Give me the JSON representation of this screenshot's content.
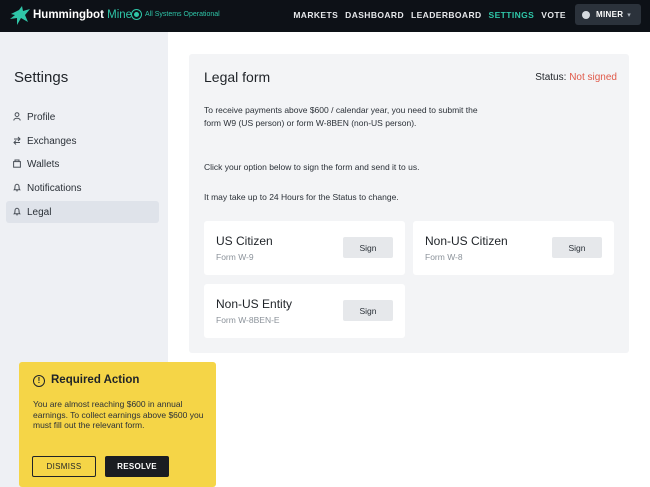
{
  "header": {
    "brand_name": "Hummingbot",
    "brand_product": "Miner",
    "system_status": "All Systems Operational",
    "nav": [
      "MARKETS",
      "DASHBOARD",
      "LEADERBOARD",
      "SETTINGS",
      "VOTE"
    ],
    "active_nav": "SETTINGS",
    "account_label": "MINER",
    "colors": {
      "accent": "#2fc6a8",
      "background": "#0d1117"
    }
  },
  "sidebar": {
    "title": "Settings",
    "items": [
      {
        "label": "Profile",
        "icon": "user-icon"
      },
      {
        "label": "Exchanges",
        "icon": "exchange-icon"
      },
      {
        "label": "Wallets",
        "icon": "wallet-icon"
      },
      {
        "label": "Notifications",
        "icon": "bell-icon"
      },
      {
        "label": "Legal",
        "icon": "bell-icon",
        "active": true
      }
    ]
  },
  "legal": {
    "title": "Legal form",
    "status_label": "Status:",
    "status_value": "Not signed",
    "status_color": "#e05a4a",
    "paragraphs": [
      "To receive payments above $600 / calendar year, you need to submit the form W9 (US person) or form W-8BEN (non-US person).",
      "Click your option below to sign the form and send it to us.",
      "It may take up to 24 Hours for the Status to change."
    ],
    "options": [
      {
        "title": "US Citizen",
        "form": "Form W-9",
        "button": "Sign"
      },
      {
        "title": "Non-US Citizen",
        "form": "Form W-8",
        "button": "Sign"
      },
      {
        "title": "Non-US Entity",
        "form": "Form W-8BEN-E",
        "button": "Sign"
      }
    ]
  },
  "toast": {
    "title": "Required Action",
    "body": "You are almost reaching $600 in annual earnings. To collect earnings above $600 you must fill out the relevant form.",
    "dismiss_label": "DISMISS",
    "resolve_label": "RESOLVE",
    "color": "#f5d547"
  }
}
